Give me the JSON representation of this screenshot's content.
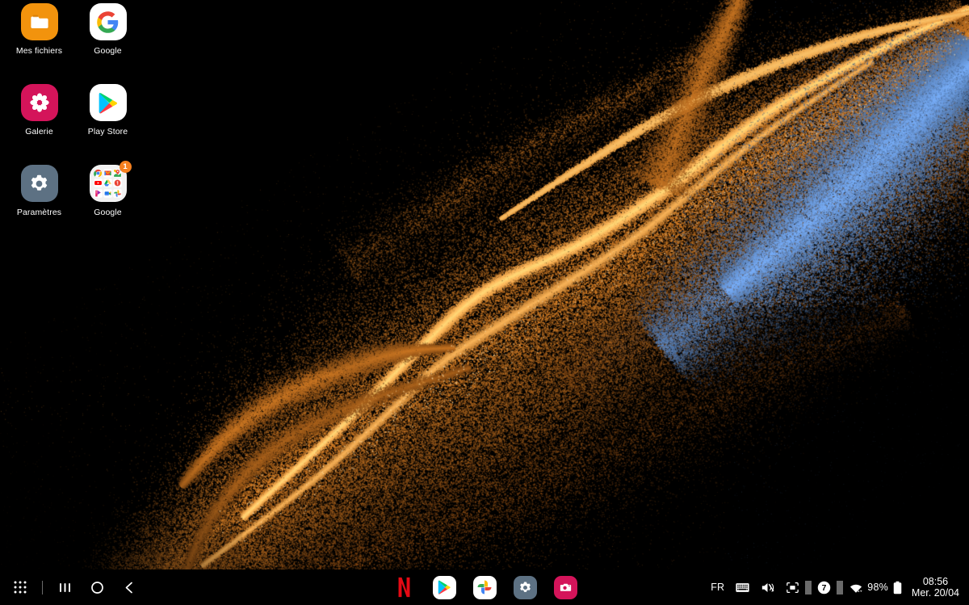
{
  "wallpaper": {
    "name": "particle-flow-wallpaper",
    "background": "#000000",
    "orange": "#e0862a",
    "amber_highlight": "#f6bf6b",
    "blue": "#5d86bf",
    "deep_orange": "#8a4a14"
  },
  "home_screen": {
    "apps": [
      {
        "id": "my-files",
        "label": "Mes fichiers",
        "icon": "folder-icon",
        "bg": "#f2930d"
      },
      {
        "id": "google",
        "label": "Google",
        "icon": "google-g-icon",
        "bg": "#ffffff"
      },
      {
        "id": "gallery",
        "label": "Galerie",
        "icon": "flower-icon",
        "bg": "#d4145a"
      },
      {
        "id": "play-store",
        "label": "Play Store",
        "icon": "play-triangle-icon",
        "bg": "#ffffff"
      },
      {
        "id": "settings",
        "label": "Paramètres",
        "icon": "gear-icon",
        "bg": "#5d7183"
      },
      {
        "id": "google-folder",
        "label": "Google",
        "icon": "app-folder-icon",
        "bg": "#f2f2f2",
        "badge": "1",
        "badge_color": "#f5801f",
        "folder_apps": [
          "chrome-icon",
          "gmail-icon",
          "maps-icon",
          "youtube-icon",
          "drive-icon",
          "google-one-icon",
          "play-movies-icon",
          "meet-icon",
          "photos-icon"
        ]
      }
    ]
  },
  "taskbar": {
    "nav": [
      {
        "id": "all-apps",
        "icon": "apps-grid-icon",
        "label": "Toutes les applications"
      },
      {
        "id": "divider-1",
        "icon": "divider"
      },
      {
        "id": "recents",
        "icon": "recents-icon",
        "label": "Applications récentes"
      },
      {
        "id": "home",
        "icon": "home-circle-icon",
        "label": "Accueil"
      },
      {
        "id": "back",
        "icon": "back-chevron-icon",
        "label": "Retour"
      }
    ],
    "dock": [
      {
        "id": "netflix",
        "icon": "netflix-icon",
        "label": "Netflix",
        "bg": "#000000",
        "accent": "#e50914"
      },
      {
        "id": "play-store",
        "icon": "play-triangle-icon",
        "label": "Play Store",
        "bg": "#ffffff"
      },
      {
        "id": "photos",
        "icon": "google-photos-icon",
        "label": "Google Photos",
        "bg": "#ffffff"
      },
      {
        "id": "settings",
        "icon": "gear-icon",
        "label": "Paramètres",
        "bg": "#5d7183"
      },
      {
        "id": "camera",
        "icon": "camera-icon",
        "label": "Appareil photo",
        "bg": "#d4145a"
      }
    ],
    "status": {
      "language": "FR",
      "keyboard_icon": "keyboard-icon",
      "sound_icon": "mute-vibrate-icon",
      "capture_icon": "screen-capture-icon",
      "notification_count": "7",
      "wifi_icon": "wifi-icon",
      "battery_percent": "98%",
      "battery_icon": "battery-full-icon",
      "time": "08:56",
      "date": "Mer. 20/04"
    }
  }
}
